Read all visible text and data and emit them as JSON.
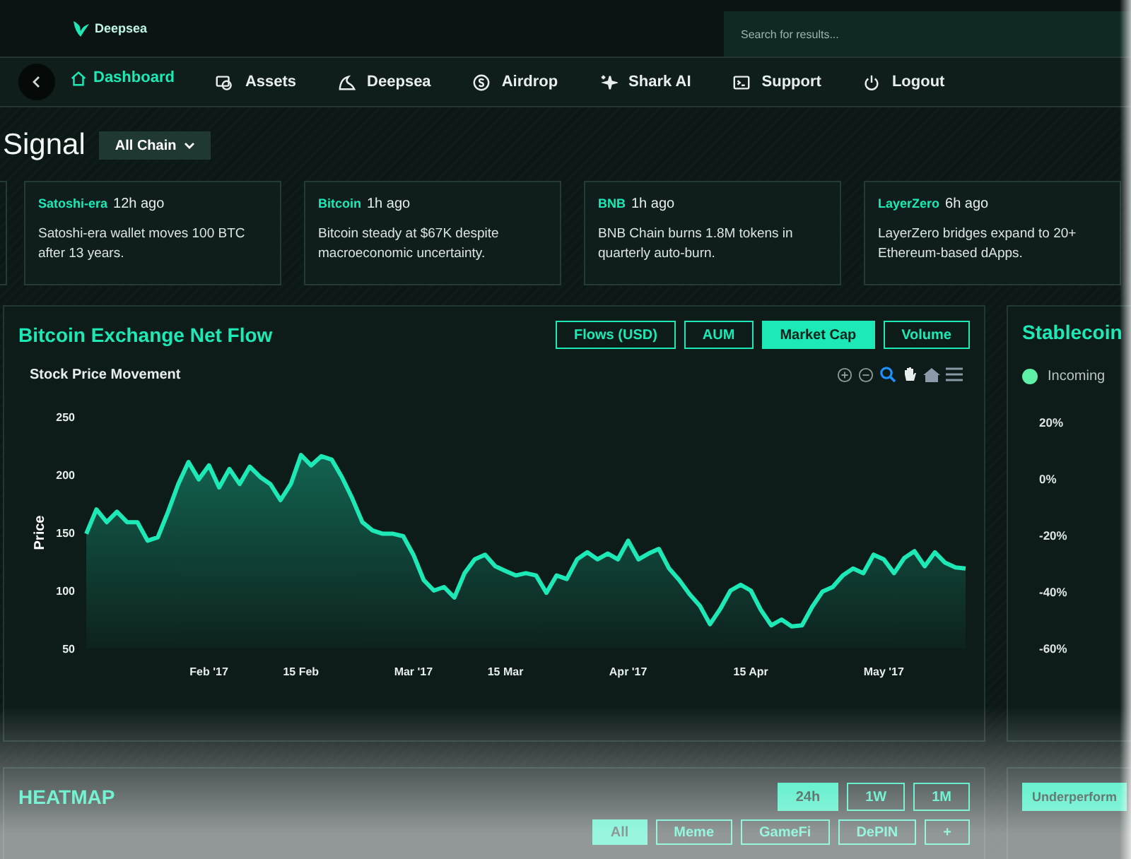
{
  "brand": {
    "name": "Deepsea"
  },
  "search": {
    "placeholder": "Search for results..."
  },
  "nav": {
    "items": [
      {
        "label": "Dashboard",
        "selected": true
      },
      {
        "label": "Assets",
        "selected": false
      },
      {
        "label": "Deepsea",
        "selected": false
      },
      {
        "label": "Airdrop",
        "selected": false
      },
      {
        "label": "Shark AI",
        "selected": false
      },
      {
        "label": "Support",
        "selected": false
      },
      {
        "label": "Logout",
        "selected": false
      }
    ]
  },
  "signal": {
    "title": "Signal",
    "filter": "All Chain",
    "cards": [
      {
        "source": "Satoshi-era",
        "time": "12h ago",
        "text": "Satoshi-era wallet moves 100 BTC after 13 years."
      },
      {
        "source": "Bitcoin",
        "time": "1h ago",
        "text": "Bitcoin steady at $67K despite macroeconomic uncertainty."
      },
      {
        "source": "BNB",
        "time": "1h ago",
        "text": "BNB Chain burns 1.8M tokens in quarterly auto-burn."
      },
      {
        "source": "LayerZero",
        "time": "6h ago",
        "text": "LayerZero bridges expand to 20+ Ethereum-based dApps."
      }
    ]
  },
  "net_flow": {
    "title": "Bitcoin Exchange Net Flow",
    "metrics": [
      {
        "label": "Flows (USD)",
        "selected": false
      },
      {
        "label": "AUM",
        "selected": false
      },
      {
        "label": "Market Cap",
        "selected": true
      },
      {
        "label": "Volume",
        "selected": false
      }
    ],
    "chart_data": {
      "type": "area",
      "title": "Stock Price Movement",
      "ylabel": "Price",
      "categories": [
        null,
        null,
        null,
        null,
        null,
        null,
        null,
        null,
        null,
        null,
        null,
        null,
        "Feb '17",
        null,
        null,
        null,
        null,
        null,
        null,
        null,
        null,
        "15 Feb",
        null,
        null,
        null,
        null,
        null,
        null,
        null,
        null,
        null,
        null,
        "Mar '17",
        null,
        null,
        null,
        null,
        null,
        null,
        null,
        null,
        "15 Mar",
        null,
        null,
        null,
        null,
        null,
        null,
        null,
        null,
        null,
        null,
        null,
        "Apr '17",
        null,
        null,
        null,
        null,
        null,
        null,
        null,
        null,
        null,
        null,
        null,
        "15 Apr",
        null,
        null,
        null,
        null,
        null,
        null,
        null,
        null,
        null,
        null,
        null,
        null,
        "May '17",
        null,
        null,
        null,
        null,
        null,
        null,
        null,
        null
      ],
      "series": [
        {
          "color": "#1de9b6",
          "values": [
            149,
            170,
            159,
            168,
            159,
            159,
            143,
            146,
            168,
            192,
            211,
            196,
            208,
            189,
            205,
            192,
            207,
            198,
            192,
            178,
            192,
            217,
            208,
            216,
            213,
            198,
            180,
            159,
            152,
            149,
            149,
            147,
            131,
            109,
            100,
            103,
            94,
            115,
            127,
            131,
            121,
            117,
            113,
            115,
            113,
            98,
            113,
            110,
            127,
            133,
            127,
            132,
            127,
            143,
            127,
            132,
            136,
            119,
            109,
            97,
            87,
            71,
            84,
            100,
            105,
            100,
            83,
            70,
            75,
            69,
            70,
            86,
            99,
            103,
            113,
            119,
            115,
            131,
            127,
            115,
            128,
            134,
            121,
            133,
            124,
            120,
            119
          ]
        }
      ],
      "ylim": [
        50,
        250
      ],
      "yticks": [
        50,
        100,
        150,
        200,
        250
      ]
    }
  },
  "stablecoin": {
    "title": "Stablecoin",
    "legend": [
      {
        "label": "Incoming",
        "color": "#5ef0a6"
      }
    ],
    "y_axis_labels": [
      "20%",
      "0%",
      "-20%",
      "-40%",
      "-60%"
    ]
  },
  "heatmap": {
    "title": "HEATMAP",
    "periods": [
      {
        "label": "24h",
        "selected": true
      },
      {
        "label": "1W",
        "selected": false
      },
      {
        "label": "1M",
        "selected": false
      }
    ],
    "categories": [
      {
        "label": "All",
        "selected": true
      },
      {
        "label": "Meme",
        "selected": false
      },
      {
        "label": "GameFi",
        "selected": false
      },
      {
        "label": "DePIN",
        "selected": false
      },
      {
        "label": "+",
        "selected": false
      }
    ]
  },
  "performance_filter": {
    "label": "Underperform"
  }
}
